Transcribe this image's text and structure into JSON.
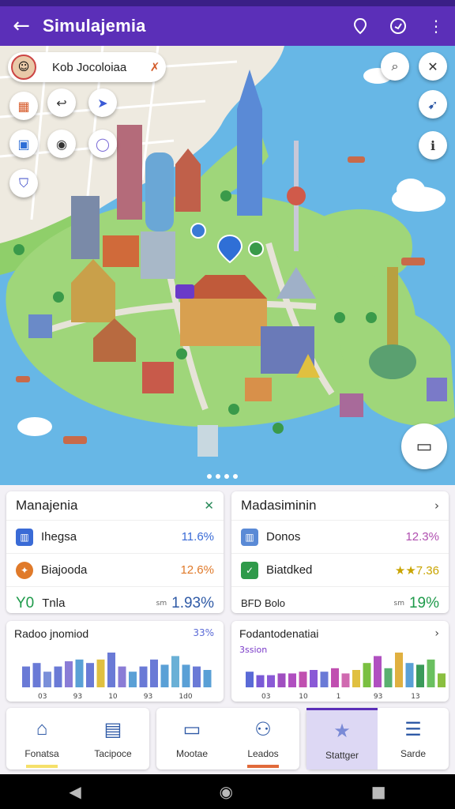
{
  "appbar": {
    "title": "Simulajemia",
    "back_icon": "arrow-left-icon",
    "actions": [
      "map-marker-icon",
      "compass-icon",
      "more-vert-icon"
    ]
  },
  "map": {
    "search_chip_text": "Kob Jocoloiaa",
    "pin_label": "i",
    "colors": {
      "water": "#67b7e6",
      "land": "#9fd67a",
      "roads": "#e5e3dc"
    }
  },
  "cards": {
    "left": {
      "title": "Manajenia",
      "rows": [
        {
          "label": "Ihegsa",
          "value": "11.6%",
          "color": "#3a6bd6"
        },
        {
          "label": "Biajooda",
          "value": "12.6%",
          "color": "#e07a2a"
        },
        {
          "label": "Tnla",
          "prefix": "Y0",
          "sub": "sm",
          "value": "1.93%",
          "color": "#2f5aa6"
        }
      ]
    },
    "right": {
      "title": "Madasiminin",
      "rows": [
        {
          "label": "Donos",
          "value": "12.3%",
          "color": "#b04fb0"
        },
        {
          "label": "Biatdked",
          "value": "★★7.36",
          "color": "#c9a400"
        },
        {
          "label": "Bolo",
          "prefix": "BFD",
          "sub": "sm",
          "value": "19%",
          "color": "#1e9a4a"
        }
      ]
    }
  },
  "charts": {
    "left": {
      "title": "Radoo jnomiod",
      "value": "33%",
      "ticks": [
        "03",
        "93",
        "10",
        "93",
        "1d0"
      ]
    },
    "right": {
      "title": "Fodantodenatiai",
      "legend": "3ssion",
      "ticks": [
        "03",
        "10",
        "1",
        "93",
        "13"
      ]
    }
  },
  "chart_data": [
    {
      "type": "bar",
      "title": "Radoo jnomiod",
      "values": [
        6,
        7,
        4.5,
        6,
        7.5,
        8,
        7,
        8,
        10,
        6,
        4.5,
        6,
        8,
        6.5,
        9,
        6.5,
        6,
        5
      ],
      "colors": [
        "#6a7ad6",
        "#6a7ad6",
        "#7a8fd9",
        "#6a7ad6",
        "#8a7cd6",
        "#5aa0d6",
        "#6a7ad6",
        "#e0c040",
        "#6a7ad6",
        "#8a7cd6",
        "#5aa0d6",
        "#6a7ad6",
        "#6a7ad6",
        "#5aa0d6",
        "#6ab0d6",
        "#5aa0d6",
        "#6a7ad6",
        "#5aa0d6"
      ],
      "ylim": [
        0,
        10
      ]
    },
    {
      "type": "bar",
      "title": "Fodantodenatiai",
      "values": [
        4.5,
        3.5,
        3.5,
        4,
        4,
        4.5,
        5,
        4.5,
        5.5,
        4,
        5,
        7,
        9,
        5.5,
        10,
        7,
        6.5,
        8,
        4
      ],
      "colors": [
        "#5a6ad6",
        "#7a5ad6",
        "#8a5ad6",
        "#a04fc0",
        "#b04fc0",
        "#c04fb0",
        "#8a5ad6",
        "#6a7ad6",
        "#c04fb0",
        "#d06ab0",
        "#e0c040",
        "#7ac040",
        "#b050c0",
        "#5ab070",
        "#e0b040",
        "#5aa0d6",
        "#3a9a5a",
        "#6ac060",
        "#8abf40"
      ],
      "ylim": [
        0,
        10
      ]
    }
  ],
  "bottomnav": [
    {
      "label": "Fonatsa",
      "icon": "home-icon",
      "active": false,
      "underline": "#f5e06a"
    },
    {
      "label": "Tacipoce",
      "icon": "chat-icon",
      "active": false,
      "underline": ""
    },
    {
      "label": "Mootae",
      "icon": "message-icon",
      "active": false,
      "underline": ""
    },
    {
      "label": "Leados",
      "icon": "people-icon",
      "active": false,
      "underline": "#e06a3a"
    },
    {
      "label": "Stattger",
      "icon": "star-icon",
      "active": true,
      "underline": ""
    },
    {
      "label": "Sarde",
      "icon": "list-icon",
      "active": false,
      "underline": ""
    }
  ]
}
